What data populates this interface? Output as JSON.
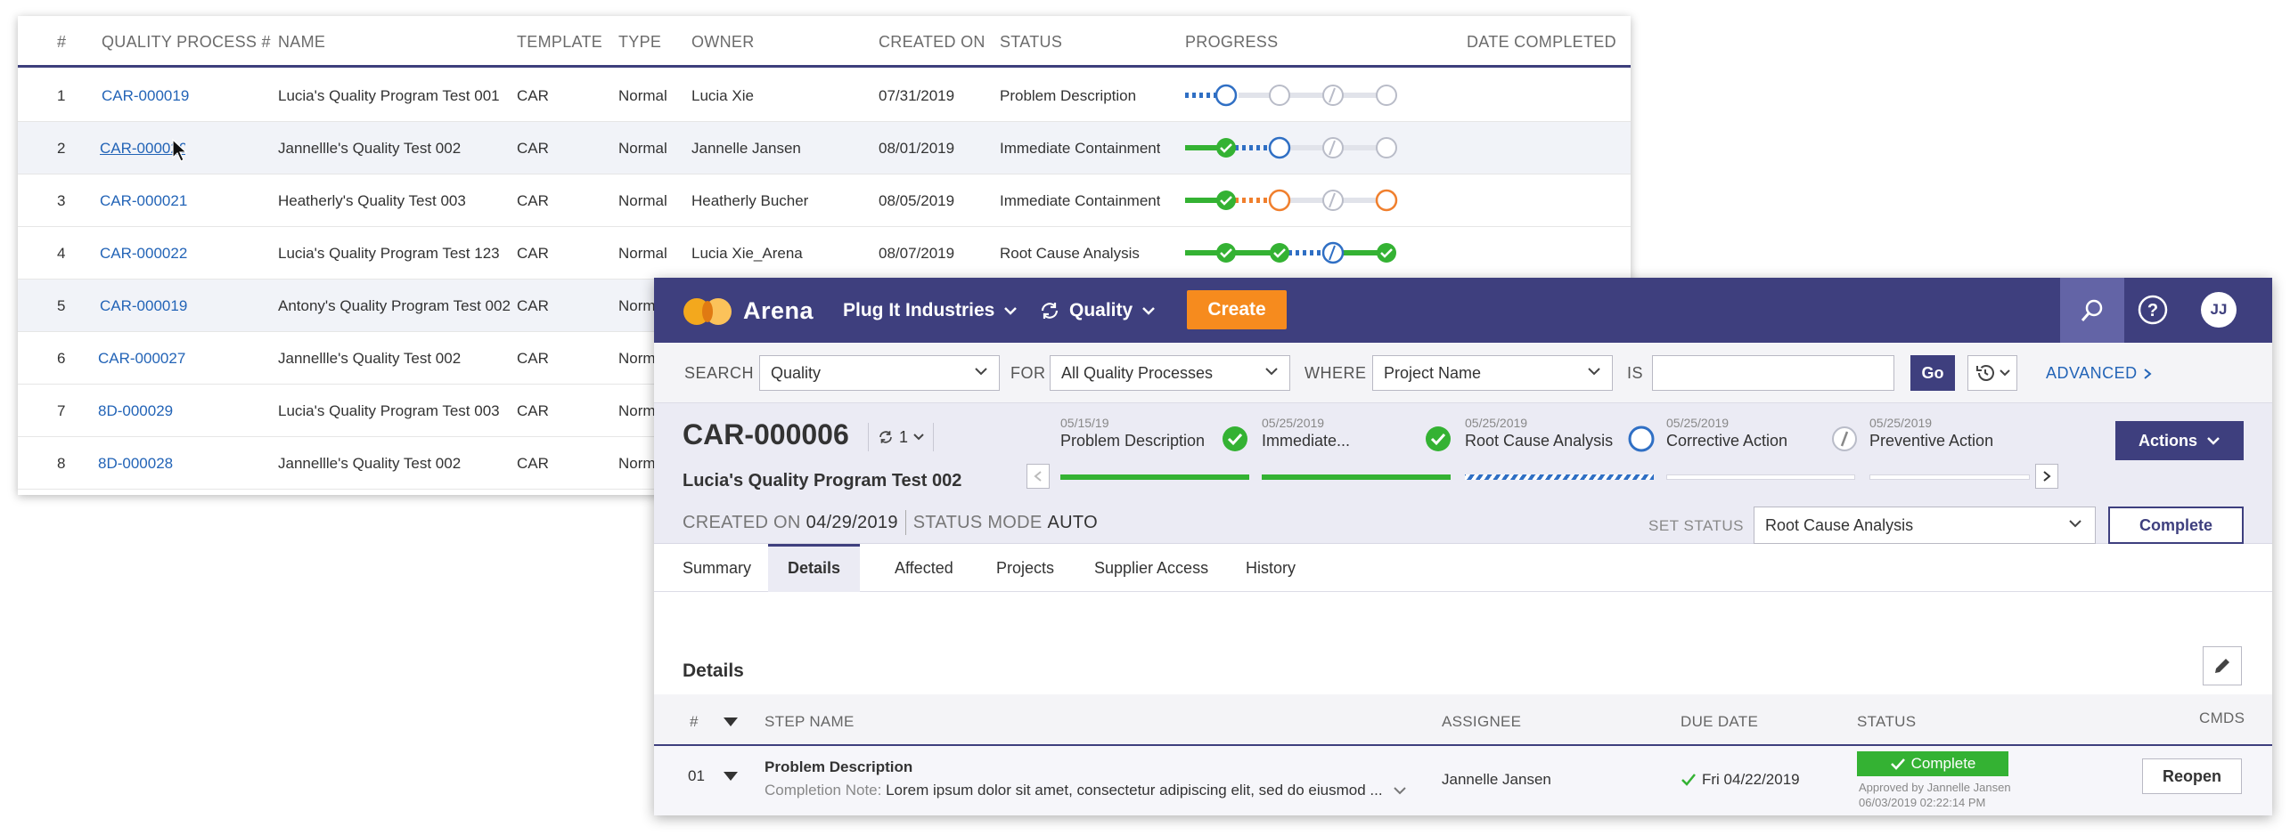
{
  "list": {
    "headers": [
      "#",
      "QUALITY PROCESS #",
      "NAME",
      "TEMPLATE",
      "TYPE",
      "OWNER",
      "CREATED ON",
      "STATUS",
      "PROGRESS",
      "DATE COMPLETED"
    ],
    "rows": [
      {
        "num": "1",
        "id": "CAR-000019",
        "name": "Lucia's Quality Program Test 001",
        "template": "CAR",
        "type": "Normal",
        "owner": "Lucia Xie",
        "created": "07/31/2019",
        "status": "Problem Description"
      },
      {
        "num": "2",
        "id": "CAR-000020",
        "name": "Jannellle's Quality Test 002",
        "template": "CAR",
        "type": "Normal",
        "owner": "Jannelle Jansen",
        "created": "08/01/2019",
        "status": "Immediate Containment"
      },
      {
        "num": "3",
        "id": "CAR-000021",
        "name": "Heatherly's Quality Test 003",
        "template": "CAR",
        "type": "Normal",
        "owner": "Heatherly Bucher",
        "created": "08/05/2019",
        "status": "Immediate Containment"
      },
      {
        "num": "4",
        "id": "CAR-000022",
        "name": "Lucia's Quality Program Test 123",
        "template": "CAR",
        "type": "Normal",
        "owner": "Lucia Xie_Arena",
        "created": "08/07/2019",
        "status": "Root Cause Analysis"
      },
      {
        "num": "5",
        "id": "CAR-000019",
        "name": "Antony's Quality Program Test 002",
        "template": "CAR",
        "type": "Normal",
        "owner": "",
        "created": "",
        "status": ""
      },
      {
        "num": "6",
        "id": "CAR-000027",
        "name": "Jannellle's Quality Test 002",
        "template": "CAR",
        "type": "Normal",
        "owner": "",
        "created": "",
        "status": ""
      },
      {
        "num": "7",
        "id": "8D-000029",
        "name": "Lucia's Quality Program Test 003",
        "template": "CAR",
        "type": "Normal",
        "owner": "",
        "created": "",
        "status": ""
      },
      {
        "num": "8",
        "id": "8D-000028",
        "name": "Jannellle's Quality Test 002",
        "template": "CAR",
        "type": "Normal",
        "owner": "",
        "created": "",
        "status": ""
      }
    ]
  },
  "topbar": {
    "brand": "Arena",
    "company": "Plug It Industries",
    "module": "Quality",
    "create_label": "Create",
    "avatar_initials": "JJ",
    "accent_color": "#3e3f7e",
    "create_color": "#f68b1e"
  },
  "search": {
    "search_label": "SEARCH",
    "search_value": "Quality",
    "for_label": "FOR",
    "for_value": "All Quality Processes",
    "where_label": "WHERE",
    "where_value": "Project Name",
    "is_label": "IS",
    "is_value": "",
    "go_label": "Go",
    "advanced_label": "ADVANCED"
  },
  "record": {
    "id": "CAR-000006",
    "revision": "1",
    "name": "Lucia's Quality Program Test 002",
    "created_label": "CREATED ON",
    "created_value": "04/29/2019",
    "mode_label": "STATUS MODE",
    "mode_value": "AUTO",
    "steps": [
      {
        "date": "05/15/19",
        "name": "Problem Description",
        "state": "done"
      },
      {
        "date": "05/25/2019",
        "name": "Immediate...",
        "state": "done"
      },
      {
        "date": "05/25/2019",
        "name": "Root Cause Analysis",
        "state": "in-progress"
      },
      {
        "date": "05/25/2019",
        "name": "Corrective Action",
        "state": "todo"
      },
      {
        "date": "05/25/2019",
        "name": "Preventive Action",
        "state": "todo"
      }
    ],
    "actions_label": "Actions",
    "set_status_label": "SET STATUS",
    "set_status_value": "Root Cause Analysis",
    "complete_label": "Complete"
  },
  "tabs": [
    "Summary",
    "Details",
    "Affected",
    "Projects",
    "Supplier Access",
    "History"
  ],
  "details": {
    "title": "Details",
    "headers": {
      "num": "#",
      "step": "STEP NAME",
      "assignee": "ASSIGNEE",
      "due": "DUE DATE",
      "status": "STATUS",
      "cmds": "CMDS"
    },
    "row": {
      "num": "01",
      "step_name": "Problem Description",
      "note_label": "Completion Note:",
      "note_text": "Lorem ipsum dolor sit amet, consectetur adipiscing elit, sed do eiusmod ...",
      "assignee": "Jannelle Jansen",
      "due": "Fri 04/22/2019",
      "status": "Complete",
      "approved_by": "Approved by Jannelle Jansen",
      "approved_on": "06/03/2019 02:22:14 PM",
      "reopen_label": "Reopen"
    }
  }
}
